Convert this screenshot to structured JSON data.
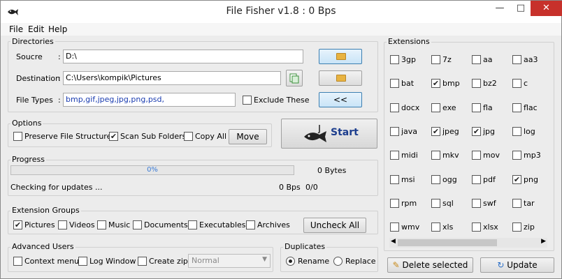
{
  "window": {
    "title": "File Fisher v1.8 : 0 Bps"
  },
  "menu": [
    "File",
    "Edit",
    "Help"
  ],
  "directories": {
    "group_label": "Directories",
    "source_label": "Soucre",
    "source_value": "D:\\",
    "destination_label": "Destination",
    "destination_value": "C:\\Users\\kompik\\Pictures",
    "filetypes_label": "File Types",
    "filetypes_value": "bmp,gif,jpeg,jpg,png,psd,",
    "exclude_label": "Exclude These",
    "collapse_btn": "<<"
  },
  "options": {
    "group_label": "Options",
    "preserve": "Preserve File Structure",
    "scan_sub": "Scan Sub Folders",
    "copy_all": "Copy All",
    "move_btn": "Move",
    "start_btn": "Start"
  },
  "progress": {
    "group_label": "Progress",
    "percent": "0%",
    "bytes": "0 Bytes",
    "status": "Checking for updates ...",
    "speed": "0 Bps",
    "count": "0/0"
  },
  "ext_groups": {
    "group_label": "Extension Groups",
    "pictures": "Pictures",
    "videos": "Videos",
    "music": "Music",
    "documents": "Documents",
    "executables": "Executables",
    "archives": "Archives",
    "uncheck_btn": "Uncheck All"
  },
  "advanced": {
    "group_label": "Advanced Users",
    "context": "Context menu",
    "log": "Log Window",
    "zip": "Create zip",
    "select": "Normal"
  },
  "duplicates": {
    "group_label": "Duplicates",
    "rename": "Rename",
    "replace": "Replace"
  },
  "extensions": {
    "group_label": "Extensions",
    "rows": [
      [
        "3gp",
        "7z",
        "aa",
        "aa3"
      ],
      [
        "bat",
        "bmp",
        "bz2",
        "c"
      ],
      [
        "docx",
        "exe",
        "fla",
        "flac"
      ],
      [
        "java",
        "jpeg",
        "jpg",
        "log"
      ],
      [
        "midi",
        "mkv",
        "mov",
        "mp3"
      ],
      [
        "msi",
        "ogg",
        "pdf",
        "png"
      ],
      [
        "rpm",
        "sql",
        "swf",
        "tar"
      ],
      [
        "wmv",
        "xls",
        "xlsx",
        "zip"
      ]
    ],
    "checked": [
      "bmp",
      "jpeg",
      "jpg",
      "png"
    ]
  },
  "bottom": {
    "delete_btn": "Delete selected",
    "update_btn": "Update"
  }
}
